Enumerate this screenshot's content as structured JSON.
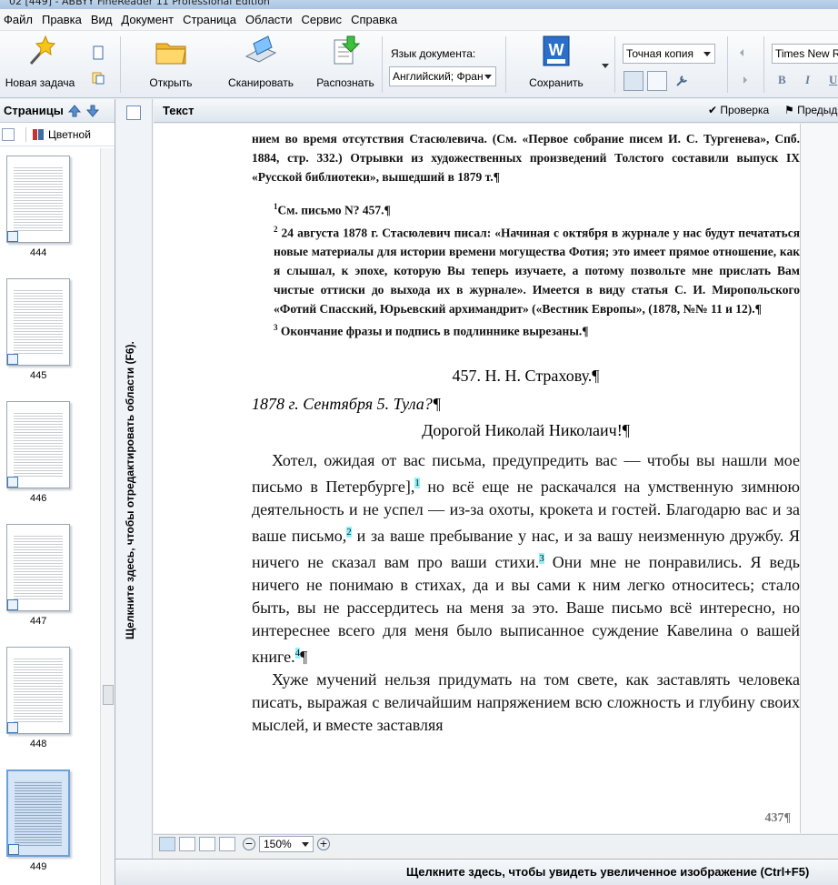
{
  "window": {
    "title": "02 [449] - ABBYY FineReader 11 Professional Edition"
  },
  "menu": [
    "Файл",
    "Правка",
    "Вид",
    "Документ",
    "Страница",
    "Области",
    "Сервис",
    "Справка"
  ],
  "toolbar": {
    "new_task": "Новая задача",
    "open": "Открыть",
    "scan": "Сканировать",
    "recognize": "Распознать",
    "doc_language_label": "Язык документа:",
    "doc_language_value": "Английский; Фран",
    "save": "Сохранить",
    "save_mode": "Точная копия",
    "font": "Times New R",
    "bold": "B",
    "italic": "I",
    "underline": "U"
  },
  "pages_pane": {
    "title": "Страницы",
    "color_mode": "Цветной",
    "thumbnails": [
      {
        "num": "444"
      },
      {
        "num": "445"
      },
      {
        "num": "446"
      },
      {
        "num": "447"
      },
      {
        "num": "448"
      },
      {
        "num": "449"
      }
    ]
  },
  "side_hint": "Щелкните здесь, чтобы отредактировать области (F6).",
  "text_pane": {
    "title": "Текст",
    "check": "Проверка",
    "preview": "Предыд"
  },
  "document": {
    "p0": "нием во время отсутствия Стасюлевича. (См. «Первое собрание писем И. С. Тургенева», Спб. 1884, стр. 332.) Отрывки из художественных произведений Толстого составили выпуск IX «Русской библиотеки», вышедший в 1879 т.¶",
    "fn1": "См. письмо N? 457.¶",
    "fn2": "24 августа 1878 г. Стасюлевич писал: «Начиная с октября в журнале у нас будут печататься новые материалы для истории времени могущества Фотия; это имеет прямое отношение, как я слышал, к эпохе, которую Вы теперь изучаете, а потому позвольте мне прислать Вам чистые оттиски до выхода их в журнале». Имеется в виду статья С. И. Миропольского «Фотий Спасский, Юрьевский архимандрит» («Вестник Европы», (1878, №№ 11 и 12).¶",
    "fn3": "Окончание фразы и подпись в подлиннике вырезаны.¶",
    "heading": "457. Н. Н. Страхову.¶",
    "date": "1878 г. Сентября 5. Тула?¶",
    "greeting": "Дорогой Николай Николаич!¶",
    "para1a": "Хотел, ожидая от вас письма, предупредить вас — чтобы вы нашли мое письмо в Петербурге],",
    "para1b": " но всё еще не раскачался на умственную зимнюю деятельность и не успел — из-за охоты, крокета и гостей. Благодарю вас и за ваше письмо,",
    "para1c": " и за ваше пребывание у нас, и за вашу неизменную дружбу. Я ничего не сказал вам про ваши стихи.",
    "para1d": " Они мне не понравились. Я ведь ничего не понимаю в стихах, да и вы сами к ним легко относитесь; стало быть, вы не рассердитесь на меня за это. Ваше письмо всё интересно, но интереснее всего для меня было выписанное суждение Кавелина о вашей книге.",
    "para1e": "¶",
    "para2": "Хуже мучений нельзя придумать на том свете, как заставлять человека писать, выражая с величайшим напряжением всю сложность и глубину своих мыслей, и вместе заставляя",
    "page_num": "437¶"
  },
  "status": {
    "zoom": "150%"
  },
  "zoom_hint": "Щелкните здесь, чтобы увидеть увеличенное изображение (Ctrl+F5)"
}
